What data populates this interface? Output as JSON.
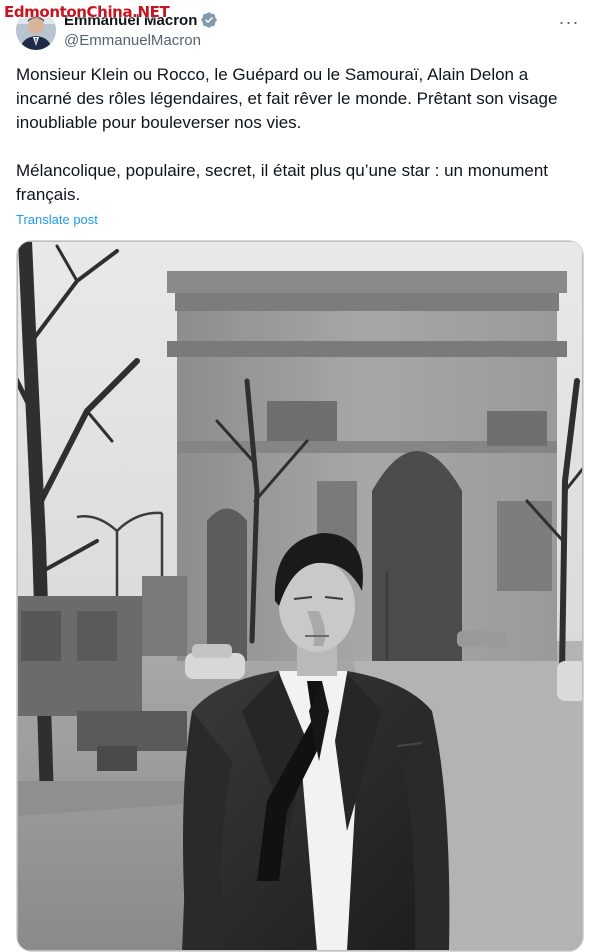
{
  "watermark": "EdmontonChina.NET",
  "author": {
    "display_name": "Emmanuel Macron",
    "handle": "@EmmanuelMacron",
    "avatar_icon": "avatar-photo",
    "verified_icon": "verified-badge-icon"
  },
  "menu": {
    "more_icon": "more-options-icon",
    "label": "···"
  },
  "post": {
    "text": "Monsieur Klein ou Rocco, le Guépard ou le Samouraï, Alain Delon a incarné des rôles légendaires, et fait rêver le monde. Prêtant son visage inoubliable pour bouleverser nos vies.\n\nMélancolique, populaire, secret, il était plus qu’une star : un monument français.",
    "translate_label": "Translate post"
  },
  "media": {
    "type": "photo"
  },
  "colors": {
    "link": "#1d9bf0",
    "secondary_text": "#536471",
    "primary_text": "#0f1419",
    "border": "#cfd9de",
    "watermark": "#c8141e"
  }
}
